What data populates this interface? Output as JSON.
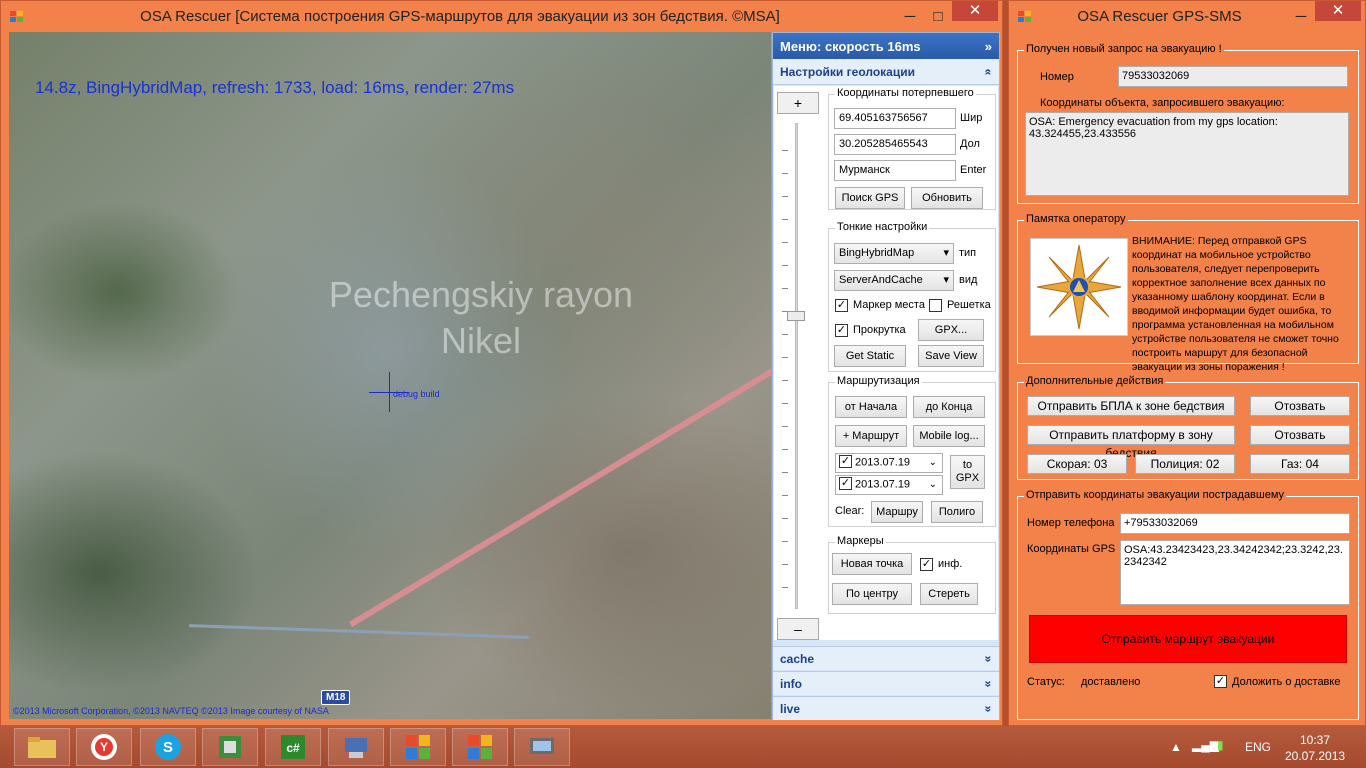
{
  "main_window": {
    "title": "OSA Rescuer [Система построения GPS-маршрутов для эвакуации из зон бедствия. ©MSA]",
    "minimize": "─",
    "maximize": "□",
    "close": "✕",
    "map": {
      "info": "14.8z, BingHybridMap, refresh: 1733, load: 16ms, render: 27ms",
      "watermark": "Pechengskiy rayon Nikel",
      "cross_label": "debug build",
      "road_sign": "M18",
      "copyright": "©2013 Microsoft Corporation, ©2013 NAVTEQ ©2013 Image courtesy of NASA"
    },
    "panel": {
      "header": "Меню: скорость 16ms",
      "header_icon": "»",
      "section": "Настройки геолокации",
      "section_icon": "«",
      "zoom_in": "+",
      "zoom_out": "–",
      "coords": {
        "legend": "Координаты потерпевшего",
        "lat": "69.405163756567",
        "lat_label": "Шир",
        "lon": "30.205285465543",
        "lon_label": "Дол",
        "city": "Мурманск",
        "city_label": "Enter",
        "search_btn": "Поиск GPS",
        "refresh_btn": "Обновить"
      },
      "fine": {
        "legend": "Тонкие настройки",
        "map_type": "BingHybridMap",
        "map_type_label": "тип",
        "mode": "ServerAndCache",
        "mode_label": "вид",
        "marker_cb": "Маркер места",
        "grid_cb": "Решетка",
        "scroll_cb": "Прокрутка",
        "gpx_btn": "GPX...",
        "static_btn": "Get Static",
        "save_btn": "Save View",
        "marker_checked": "✓",
        "grid_checked": "",
        "scroll_checked": "✓"
      },
      "routing": {
        "legend": "Маршрутизация",
        "from_btn": "от Начала",
        "to_btn": "до Конца",
        "add_btn": "+ Маршрут",
        "mobile_btn": "Mobile log...",
        "date1": "2013.07.19",
        "date2": "2013.07.19",
        "togpx_btn": "to GPX",
        "clear_label": "Clear:",
        "route_btn": "Маршру",
        "poly_btn": "Полиго"
      },
      "markers": {
        "legend": "Маркеры",
        "new_btn": "Новая точка",
        "info_cb": "инф.",
        "center_btn": "По центру",
        "erase_btn": "Стереть"
      },
      "footers": [
        {
          "label": "cache",
          "icon": "»"
        },
        {
          "label": "info",
          "icon": "»"
        },
        {
          "label": "live",
          "icon": "»"
        }
      ]
    }
  },
  "sms_window": {
    "title": "OSA Rescuer GPS-SMS",
    "minimize": "─",
    "close": "✕",
    "request": {
      "legend": "Получен новый запрос на эвакуацию !",
      "number_label": "Номер",
      "number": "79533032069",
      "coords_label": "Координаты объекта, запросившего эвакуацию:",
      "message": "OSA: Emergency evacuation from my gps location: 43.324455,23.433556"
    },
    "memo": {
      "legend": "Памятка оператору",
      "text": "ВНИМАНИЕ: Перед отправкой GPS координат на мобильное устройство пользователя, следует перепроверить корректное заполнение всех данных по указанному шаблону координат. Если в вводимой информации будет ошибка, то программа установленная на мобильном устройстве пользователя не сможет точно построить маршрут для безопасной эвакуации из зоны поражения !"
    },
    "actions": {
      "legend": "Дополнительные действия",
      "uav_btn": "Отправить БПЛА к зоне бедствия",
      "recall1": "Отозвать",
      "platform_btn": "Отправить платформу в зону бедствия",
      "recall2": "Отозвать",
      "ambulance": "Скорая: 03",
      "police": "Полиция: 02",
      "gas": "Газ: 04"
    },
    "send": {
      "legend": "Отправить координаты эвакуации пострадавшему",
      "phone_label": "Номер телефона",
      "phone": "+79533032069",
      "gps_label": "Координаты GPS",
      "gps": "OSA:43.23423423,23.34242342;23.3242,23.2342342",
      "send_btn": "Отправить маршрут эвакуации",
      "status_label": "Статус:",
      "status": "доставлено",
      "report_cb": "Доложить о доставке",
      "report_checked": "✓"
    }
  },
  "taskbar": {
    "language": "ENG",
    "time": "10:37",
    "date": "20.07.2013",
    "items": [
      "file-explorer-icon",
      "yandex-browser-icon",
      "skype-icon",
      "text-editor-icon",
      "csharp-icon",
      "network-app-icon",
      "osa-rescuer-icon",
      "osa-rescuer-gps-sms-icon",
      "remote-desktop-icon"
    ]
  }
}
